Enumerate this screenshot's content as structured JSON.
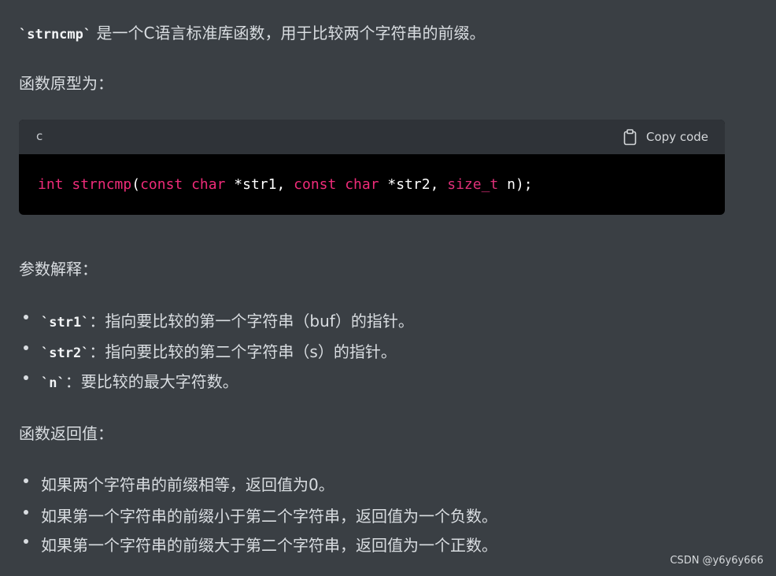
{
  "intro": {
    "code": "`strncmp`",
    "text": " 是一个C语言标准库函数，用于比较两个字符串的前缀。"
  },
  "prototype_heading": "函数原型为：",
  "code_block": {
    "language": "c",
    "copy_label": "Copy code",
    "tokens": {
      "t1": "int",
      "t2": " ",
      "t3": "strncmp",
      "t4": "(",
      "t5": "const",
      "t6": " ",
      "t7": "char",
      "t8": " *str1, ",
      "t9": "const",
      "t10": " ",
      "t11": "char",
      "t12": " *str2, ",
      "t13": "size_t",
      "t14": " n);"
    }
  },
  "params_heading": "参数解释：",
  "params": [
    {
      "code": "`str1`",
      "text": "：指向要比较的第一个字符串（buf）的指针。"
    },
    {
      "code": "`str2`",
      "text": "：指向要比较的第二个字符串（s）的指针。"
    },
    {
      "code": "`n`",
      "text": "：要比较的最大字符数。"
    }
  ],
  "return_heading": "函数返回值：",
  "returns": [
    "如果两个字符串的前缀相等，返回值为0。",
    "如果第一个字符串的前缀小于第二个字符串，返回值为一个负数。",
    "如果第一个字符串的前缀大于第二个字符串，返回值为一个正数。"
  ],
  "watermark": "CSDN @y6y6y666",
  "icons": {
    "copy": "clipboard-icon"
  },
  "colors": {
    "background": "#3a3f44",
    "code_bg": "#000000",
    "code_header_bg": "#2f3338",
    "keyword": "#ef2b79"
  }
}
